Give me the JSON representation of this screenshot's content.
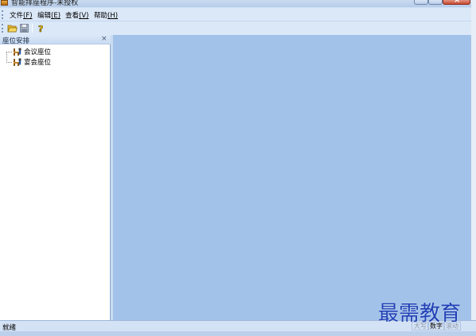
{
  "window": {
    "title": "智能排座程序-未授权"
  },
  "menu": {
    "items": [
      {
        "label": "文件",
        "accel": "(F)"
      },
      {
        "label": "编辑",
        "accel": "(E)"
      },
      {
        "label": "查看",
        "accel": "(V)"
      },
      {
        "label": "帮助",
        "accel": "(H)"
      }
    ]
  },
  "toolbar": {
    "buttons": [
      {
        "icon": "open-folder-icon"
      },
      {
        "icon": "save-disk-icon"
      },
      {
        "icon": "help-icon"
      }
    ]
  },
  "pane": {
    "title": "座位安排",
    "close": "×",
    "tree": [
      {
        "label": "会议座位",
        "icon": "chair-icon"
      },
      {
        "label": "宴会座位",
        "icon": "chair-icon"
      }
    ]
  },
  "status": {
    "text": "就绪",
    "indicators": [
      {
        "label": "大写",
        "active": false
      },
      {
        "label": "数字",
        "active": true
      },
      {
        "label": "滚动",
        "active": false
      }
    ]
  },
  "watermark": "最需教育"
}
